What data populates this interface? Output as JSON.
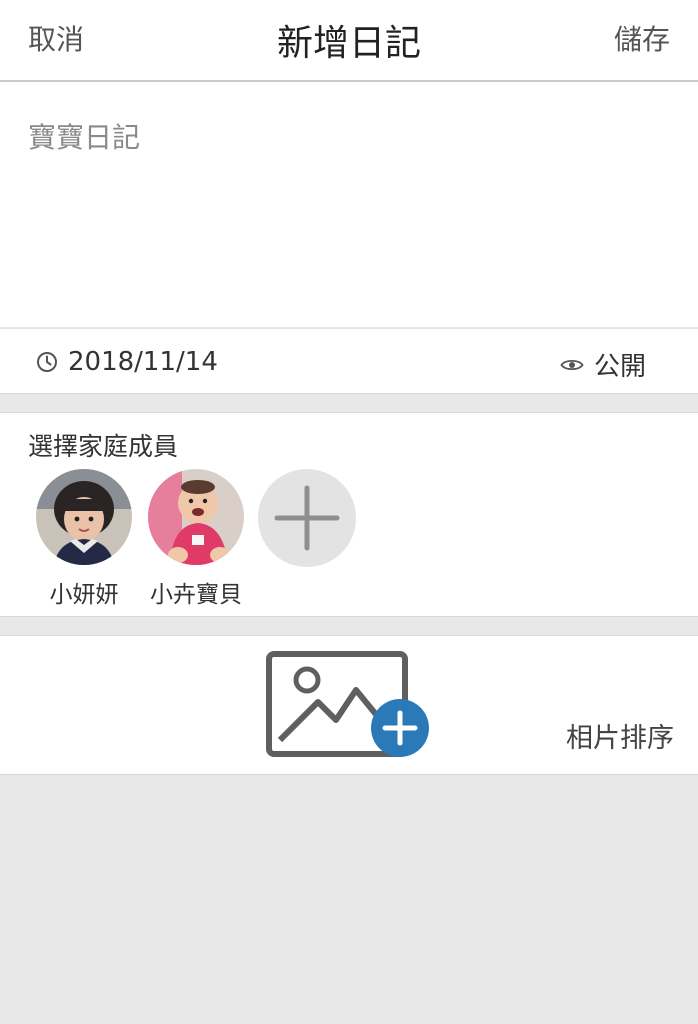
{
  "header": {
    "cancel_label": "取消",
    "title": "新增日記",
    "save_label": "儲存"
  },
  "editor": {
    "placeholder": "寶寶日記",
    "value": ""
  },
  "meta": {
    "date": "2018/11/14",
    "privacy": "公開"
  },
  "members": {
    "heading": "選擇家庭成員",
    "items": [
      {
        "name": "小妍妍",
        "avatar_color": "#5a4e6b"
      },
      {
        "name": "小卉寶貝",
        "avatar_color": "#d8566d"
      }
    ]
  },
  "photos": {
    "sort_label": "相片排序",
    "accent": "#2a7ab8"
  },
  "icons": [
    "clock-icon",
    "eye-icon",
    "plus-icon",
    "image-add-icon"
  ]
}
